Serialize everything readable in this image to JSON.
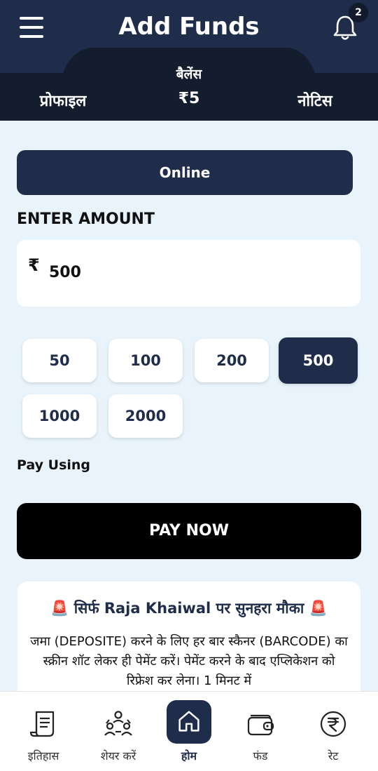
{
  "header": {
    "title": "Add Funds",
    "notification_count": "2",
    "tabs": {
      "profile": "प्रोफाइल",
      "notice": "नोटिस"
    },
    "balance_label": "बैलेंस",
    "balance_value": "₹5"
  },
  "payment_method": "Online",
  "amount": {
    "label": "ENTER AMOUNT",
    "currency_symbol": "₹",
    "value": "500"
  },
  "quick_amounts": [
    {
      "value": "50",
      "selected": false
    },
    {
      "value": "100",
      "selected": false
    },
    {
      "value": "200",
      "selected": false
    },
    {
      "value": "500",
      "selected": true
    },
    {
      "value": "1000",
      "selected": false
    },
    {
      "value": "2000",
      "selected": false
    }
  ],
  "pay_using_label": "Pay Using",
  "pay_now_label": "PAY NOW",
  "notice": {
    "title": "🚨 सिर्फ Raja Khaiwal पर सुनहरा मौका 🚨",
    "body": "जमा (DEPOSITE) करने के लिए हर बार स्कैनर (BARCODE) का स्क्रीन शॉट लेकर ही पेमेंट करें। पेमेंट करने के बाद एप्लिकेशन को रिफ्रेश कर लेना। 1 मिनट में"
  },
  "bottom_nav": [
    {
      "label": "इतिहास",
      "icon": "history-scroll-icon"
    },
    {
      "label": "शेयर करें",
      "icon": "share-users-icon"
    },
    {
      "label": "होम",
      "icon": "home-icon",
      "active": true
    },
    {
      "label": "फंड",
      "icon": "wallet-icon"
    },
    {
      "label": "रेट",
      "icon": "rupee-icon"
    }
  ],
  "colors": {
    "primary": "#1f2d4b",
    "background": "#e8f3fb",
    "pay_button": "#000000"
  }
}
